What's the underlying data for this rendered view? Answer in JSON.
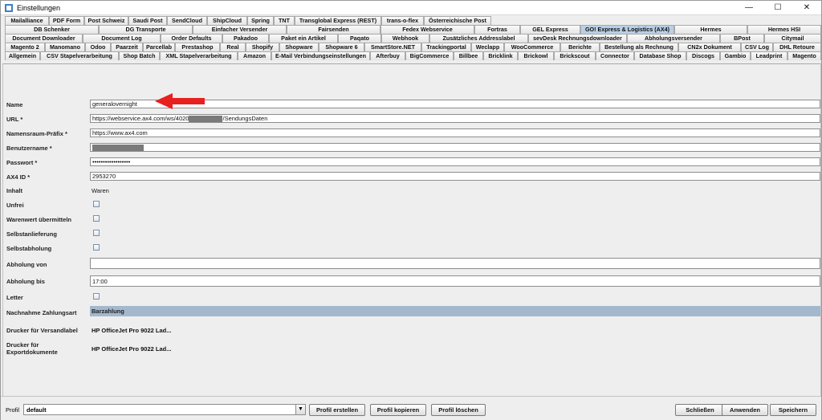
{
  "window": {
    "title": "Einstellungen"
  },
  "tabs": {
    "row1": [
      "Mailalliance",
      "PDF Form",
      "Post Schweiz",
      "Saudi Post",
      "SendCloud",
      "ShipCloud",
      "Spring",
      "TNT",
      "Transglobal Express (REST)",
      "trans-o-flex",
      "Österreichische Post"
    ],
    "row2": [
      "DB Schenker",
      "DG Transporte",
      "Einfacher Versender",
      "Fairsenden",
      "Fedex Webservice",
      "Fortras",
      "GEL Express",
      "GO! Express & Logistics (AX4)",
      "Hermes",
      "Hermes HSI"
    ],
    "row3": [
      "Document Downloader",
      "Document Log",
      "Order Defaults",
      "Pakadoo",
      "Paket ein Artikel",
      "Paqato",
      "Webhook",
      "Zusätzliches Addresslabel",
      "sevDesk Rechnungsdownloader",
      "Abholungsversender",
      "BPost",
      "Citymail"
    ],
    "row4": [
      "Magento 2",
      "Manomano",
      "Odoo",
      "Paarzeit",
      "Parcellab",
      "Prestashop",
      "Real",
      "Shopify",
      "Shopware",
      "Shopware 6",
      "SmartStore.NET",
      "Trackingportal",
      "Weclapp",
      "WooCommerce",
      "Berichte",
      "Bestellung als Rechnung",
      "CN2x Dokument",
      "CSV Log",
      "DHL Retoure"
    ],
    "row5": [
      "Allgemein",
      "CSV Stapelverarbeitung",
      "Shop Batch",
      "XML Stapelverarbeitung",
      "Amazon",
      "E-Mail Verbindungseinstellungen",
      "Afterbuy",
      "BigCommerce",
      "Billbee",
      "Bricklink",
      "Brickowl",
      "Brickscout",
      "Connector",
      "Database Shop",
      "Discogs",
      "Gambio",
      "Leadprint",
      "Magento"
    ]
  },
  "form": {
    "name_label": "Name",
    "name_value": "generalovernight",
    "url_label": "URL *",
    "url_prefix": "https://webservice.ax4.com/ws/4020",
    "url_suffix": "/SendungsDaten",
    "ns_label": "Namensraum-Präfix *",
    "ns_value": "https://www.ax4.com",
    "user_label": "Benutzername *",
    "pass_label": "Passwort *",
    "pass_value": "••••••••••••••••••",
    "ax4id_label": "AX4 ID *",
    "ax4id_value": "2953270",
    "inhalt_label": "Inhalt",
    "inhalt_value": "Waren",
    "unfrei_label": "Unfrei",
    "warenwert_label": "Warenwert übermitteln",
    "selbstanlieferung_label": "Selbstanlieferung",
    "selbstabholung_label": "Selbstabholung",
    "abholung_von_label": "Abholung von",
    "abholung_von_value": "",
    "abholung_bis_label": "Abholung bis",
    "abholung_bis_value": "17:00",
    "letter_label": "Letter",
    "nachnahme_label": "Nachnahme Zahlungsart",
    "nachnahme_value": "Barzahlung",
    "drucker_versand_label": "Drucker für Versandlabel",
    "drucker_versand_value": "HP OfficeJet Pro 9022 Lad...",
    "drucker_export_label_1": "Drucker für",
    "drucker_export_label_2": "Exportdokumente",
    "drucker_export_value": "HP OfficeJet Pro 9022 Lad..."
  },
  "bottom": {
    "profile_label": "Profil",
    "profile_value": "default",
    "btn_create": "Profil erstellen",
    "btn_copy": "Profil kopieren",
    "btn_delete": "Profil löschen",
    "btn_close": "Schließen",
    "btn_apply": "Anwenden",
    "btn_save": "Speichern"
  },
  "colors": {
    "active_tab": "#b8cfe5",
    "highlight": "#a3b8cc",
    "arrow": "#e8201f"
  }
}
